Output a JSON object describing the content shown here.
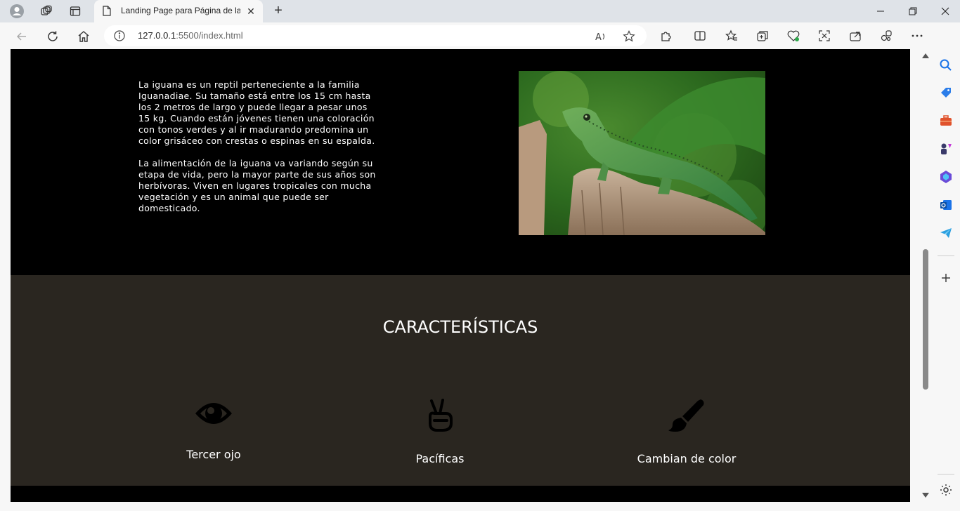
{
  "browser": {
    "tab_title": "Landing Page para Página de la I",
    "url_host": "127.0.0.1",
    "url_rest": ":5500/index.html",
    "new_tab_label": "+",
    "close_tab_label": "✕"
  },
  "page": {
    "intro_paragraph_1": "La iguana es un reptil perteneciente a la familia Iguanadiae.   Su tamaño está entre los 15 cm hasta los 2 metros de largo y puede llegar a pesar unos 15 kg.   Cuando están jóvenes tienen una coloración con tonos verdes y al ir madurando predomina un color grisáceo con crestas o espinas en su espalda.",
    "intro_paragraph_2": "La alimentación de la iguana va variando según su etapa de vida, pero la mayor parte de sus años son herbívoras.   Viven en lugares tropicales con mucha vegetación y es un animal que puede ser domesticado.",
    "features_heading": "CARACTERÍSTICAS",
    "features": [
      {
        "label": "Tercer ojo",
        "icon": "eye-icon"
      },
      {
        "label": "Pacíficas",
        "icon": "peace-hand-icon"
      },
      {
        "label": "Cambian de color",
        "icon": "paint-brush-icon"
      }
    ]
  },
  "colors": {
    "hero_bg": "#000000",
    "features_bg": "#2a2620",
    "text": "#ffffff"
  }
}
